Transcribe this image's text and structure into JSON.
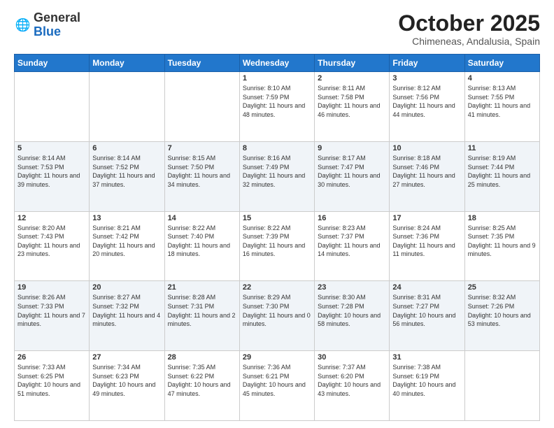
{
  "header": {
    "logo_general": "General",
    "logo_blue": "Blue",
    "month_title": "October 2025",
    "location": "Chimeneas, Andalusia, Spain"
  },
  "days_of_week": [
    "Sunday",
    "Monday",
    "Tuesday",
    "Wednesday",
    "Thursday",
    "Friday",
    "Saturday"
  ],
  "weeks": [
    [
      {
        "day": "",
        "info": ""
      },
      {
        "day": "",
        "info": ""
      },
      {
        "day": "",
        "info": ""
      },
      {
        "day": "1",
        "info": "Sunrise: 8:10 AM\nSunset: 7:59 PM\nDaylight: 11 hours and 48 minutes."
      },
      {
        "day": "2",
        "info": "Sunrise: 8:11 AM\nSunset: 7:58 PM\nDaylight: 11 hours and 46 minutes."
      },
      {
        "day": "3",
        "info": "Sunrise: 8:12 AM\nSunset: 7:56 PM\nDaylight: 11 hours and 44 minutes."
      },
      {
        "day": "4",
        "info": "Sunrise: 8:13 AM\nSunset: 7:55 PM\nDaylight: 11 hours and 41 minutes."
      }
    ],
    [
      {
        "day": "5",
        "info": "Sunrise: 8:14 AM\nSunset: 7:53 PM\nDaylight: 11 hours and 39 minutes."
      },
      {
        "day": "6",
        "info": "Sunrise: 8:14 AM\nSunset: 7:52 PM\nDaylight: 11 hours and 37 minutes."
      },
      {
        "day": "7",
        "info": "Sunrise: 8:15 AM\nSunset: 7:50 PM\nDaylight: 11 hours and 34 minutes."
      },
      {
        "day": "8",
        "info": "Sunrise: 8:16 AM\nSunset: 7:49 PM\nDaylight: 11 hours and 32 minutes."
      },
      {
        "day": "9",
        "info": "Sunrise: 8:17 AM\nSunset: 7:47 PM\nDaylight: 11 hours and 30 minutes."
      },
      {
        "day": "10",
        "info": "Sunrise: 8:18 AM\nSunset: 7:46 PM\nDaylight: 11 hours and 27 minutes."
      },
      {
        "day": "11",
        "info": "Sunrise: 8:19 AM\nSunset: 7:44 PM\nDaylight: 11 hours and 25 minutes."
      }
    ],
    [
      {
        "day": "12",
        "info": "Sunrise: 8:20 AM\nSunset: 7:43 PM\nDaylight: 11 hours and 23 minutes."
      },
      {
        "day": "13",
        "info": "Sunrise: 8:21 AM\nSunset: 7:42 PM\nDaylight: 11 hours and 20 minutes."
      },
      {
        "day": "14",
        "info": "Sunrise: 8:22 AM\nSunset: 7:40 PM\nDaylight: 11 hours and 18 minutes."
      },
      {
        "day": "15",
        "info": "Sunrise: 8:22 AM\nSunset: 7:39 PM\nDaylight: 11 hours and 16 minutes."
      },
      {
        "day": "16",
        "info": "Sunrise: 8:23 AM\nSunset: 7:37 PM\nDaylight: 11 hours and 14 minutes."
      },
      {
        "day": "17",
        "info": "Sunrise: 8:24 AM\nSunset: 7:36 PM\nDaylight: 11 hours and 11 minutes."
      },
      {
        "day": "18",
        "info": "Sunrise: 8:25 AM\nSunset: 7:35 PM\nDaylight: 11 hours and 9 minutes."
      }
    ],
    [
      {
        "day": "19",
        "info": "Sunrise: 8:26 AM\nSunset: 7:33 PM\nDaylight: 11 hours and 7 minutes."
      },
      {
        "day": "20",
        "info": "Sunrise: 8:27 AM\nSunset: 7:32 PM\nDaylight: 11 hours and 4 minutes."
      },
      {
        "day": "21",
        "info": "Sunrise: 8:28 AM\nSunset: 7:31 PM\nDaylight: 11 hours and 2 minutes."
      },
      {
        "day": "22",
        "info": "Sunrise: 8:29 AM\nSunset: 7:30 PM\nDaylight: 11 hours and 0 minutes."
      },
      {
        "day": "23",
        "info": "Sunrise: 8:30 AM\nSunset: 7:28 PM\nDaylight: 10 hours and 58 minutes."
      },
      {
        "day": "24",
        "info": "Sunrise: 8:31 AM\nSunset: 7:27 PM\nDaylight: 10 hours and 56 minutes."
      },
      {
        "day": "25",
        "info": "Sunrise: 8:32 AM\nSunset: 7:26 PM\nDaylight: 10 hours and 53 minutes."
      }
    ],
    [
      {
        "day": "26",
        "info": "Sunrise: 7:33 AM\nSunset: 6:25 PM\nDaylight: 10 hours and 51 minutes."
      },
      {
        "day": "27",
        "info": "Sunrise: 7:34 AM\nSunset: 6:23 PM\nDaylight: 10 hours and 49 minutes."
      },
      {
        "day": "28",
        "info": "Sunrise: 7:35 AM\nSunset: 6:22 PM\nDaylight: 10 hours and 47 minutes."
      },
      {
        "day": "29",
        "info": "Sunrise: 7:36 AM\nSunset: 6:21 PM\nDaylight: 10 hours and 45 minutes."
      },
      {
        "day": "30",
        "info": "Sunrise: 7:37 AM\nSunset: 6:20 PM\nDaylight: 10 hours and 43 minutes."
      },
      {
        "day": "31",
        "info": "Sunrise: 7:38 AM\nSunset: 6:19 PM\nDaylight: 10 hours and 40 minutes."
      },
      {
        "day": "",
        "info": ""
      }
    ]
  ]
}
